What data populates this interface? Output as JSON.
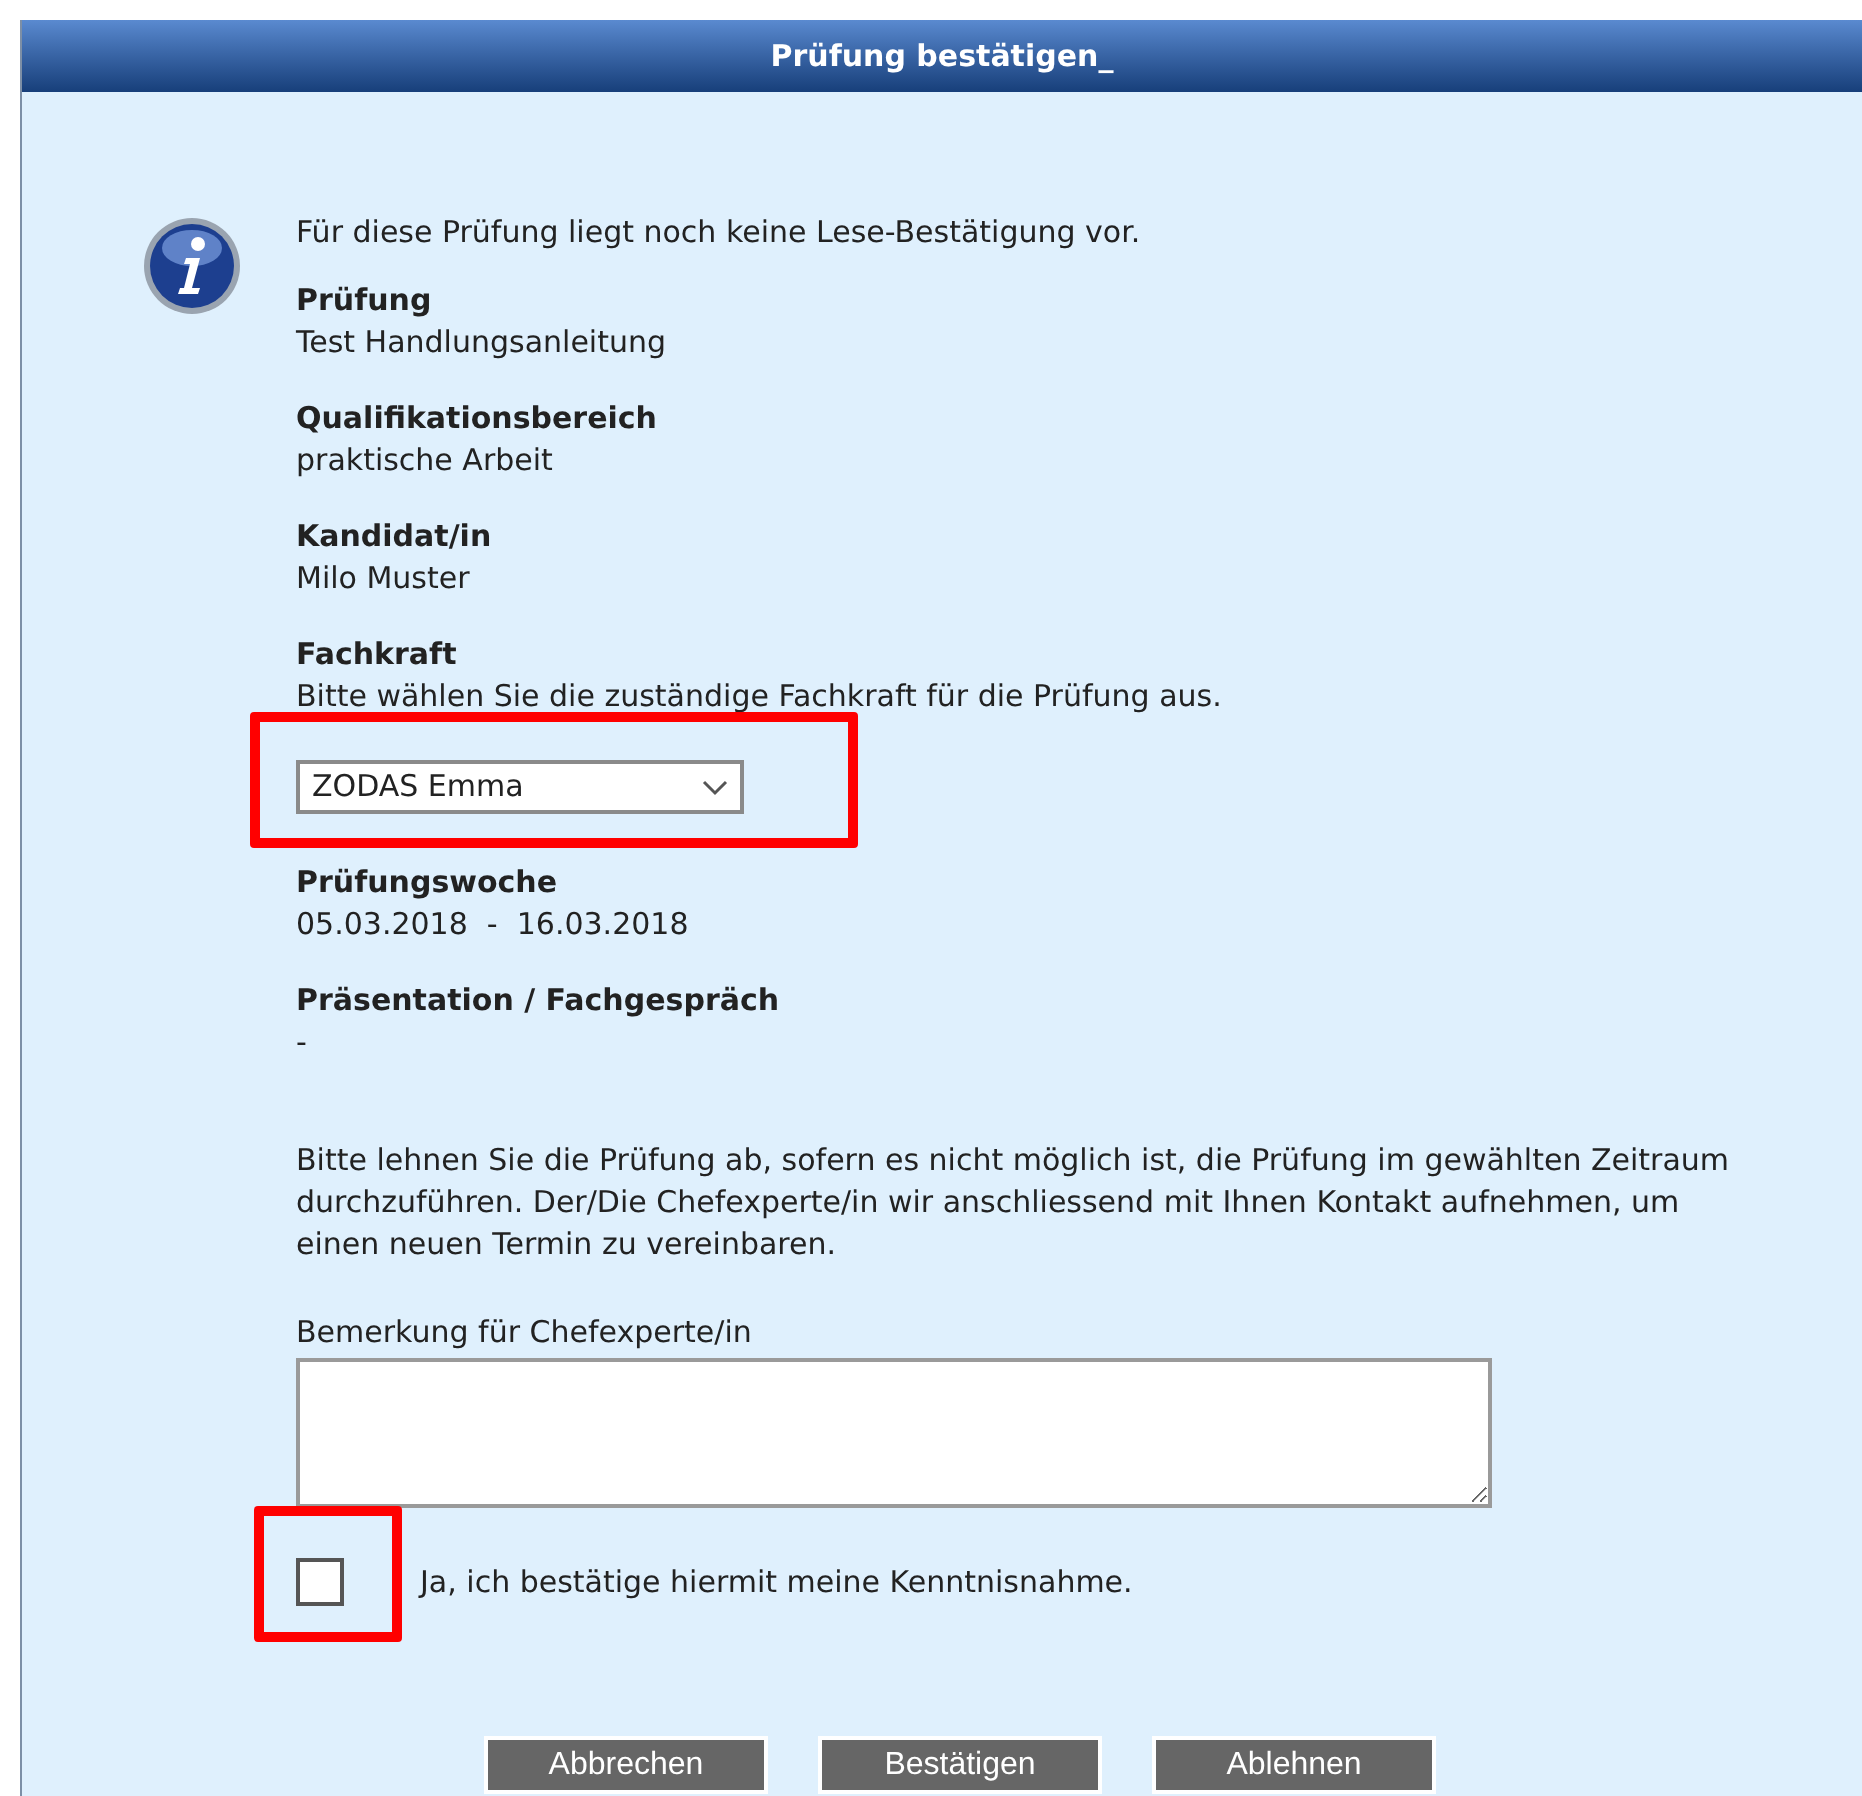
{
  "dialog": {
    "title": "Prüfung bestätigen_"
  },
  "notice": "Für diese Prüfung liegt noch keine Lese-Bestätigung vor.",
  "fields": [
    {
      "label": "Prüfung",
      "value": "Test Handlungsanleitung"
    },
    {
      "label": "Qualifikationsbereich",
      "value": "praktische Arbeit"
    },
    {
      "label": "Kandidat/in",
      "value": "Milo Muster"
    }
  ],
  "specialist": {
    "label": "Fachkraft",
    "hint": "Bitte wählen Sie die zuständige Fachkraft für die Prüfung aus.",
    "value": "ZODAS Emma",
    "highlighted": true
  },
  "fields_2": [
    {
      "label": "Prüfungswoche",
      "value": "05.03.2018  -  16.03.2018"
    },
    {
      "label": "Präsentation / Fachgespräch",
      "value": "-"
    }
  ],
  "instructions": "Bitte lehnen Sie die Prüfung ab, sofern es nicht möglich ist, die Prüfung im gewählten Zeitraum durchzuführen. Der/Die Chefexperte/in wir anschliessend mit Ihnen Kontakt aufnehmen, um einen neuen Termin zu vereinbaren.",
  "remark": {
    "label": "Bemerkung für Chefexperte/in"
  },
  "confirmation": {
    "label": "Ja, ich bestätige hiermit meine Kenntnisnahme.",
    "checked": false,
    "highlighted": true
  },
  "buttons": [
    "Abbrechen",
    "Bestätigen",
    "Ablehnen"
  ]
}
